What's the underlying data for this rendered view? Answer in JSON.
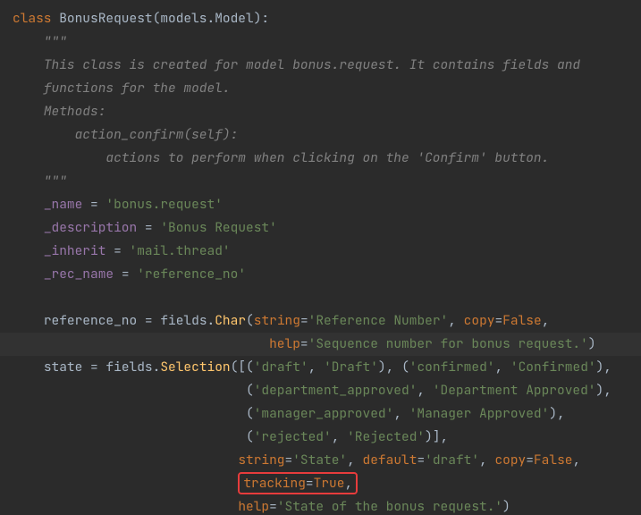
{
  "code": {
    "class_kw": "class",
    "class_name": "BonusRequest",
    "inherit_model": "models.Model",
    "doc_open": "\"\"\"",
    "doc_l1": "This class is created for model bonus.request. It contains fields and",
    "doc_l2": "functions for the model.",
    "doc_l3": "Methods:",
    "doc_l4": "action_confirm(self):",
    "doc_l5": "actions to perform when clicking on the 'Confirm' button.",
    "doc_close": "\"\"\"",
    "name_attr": "_name",
    "name_val": "'bonus.request'",
    "desc_attr": "_description",
    "desc_val": "'Bonus Request'",
    "inh_attr": "_inherit",
    "inh_val": "'mail.thread'",
    "rec_attr": "_rec_name",
    "rec_val": "'reference_no'",
    "ref_field": "reference_no",
    "fields_mod": "fields",
    "char_fn": "Char",
    "sel_fn": "Selection",
    "string_kw": "string",
    "copy_kw": "copy",
    "help_kw": "help",
    "default_kw": "default",
    "tracking_kw": "tracking",
    "true_val": "True",
    "false_val": "False",
    "ref_string": "'Reference Number'",
    "ref_help": "'Sequence number for bonus request.'",
    "state_field": "state",
    "state_pairs": {
      "draft_k": "'draft'",
      "draft_v": "'Draft'",
      "conf_k": "'confirmed'",
      "conf_v": "'Confirmed'",
      "dept_k": "'department_approved'",
      "dept_v": "'Department Approved'",
      "mgr_k": "'manager_approved'",
      "mgr_v": "'Manager Approved'",
      "rej_k": "'rejected'",
      "rej_v": "'Rejected'"
    },
    "state_string": "'State'",
    "state_default": "'draft'",
    "state_help": "'State of the bonus request.'"
  },
  "highlight": {
    "tracking_true": "tracking=True,"
  }
}
